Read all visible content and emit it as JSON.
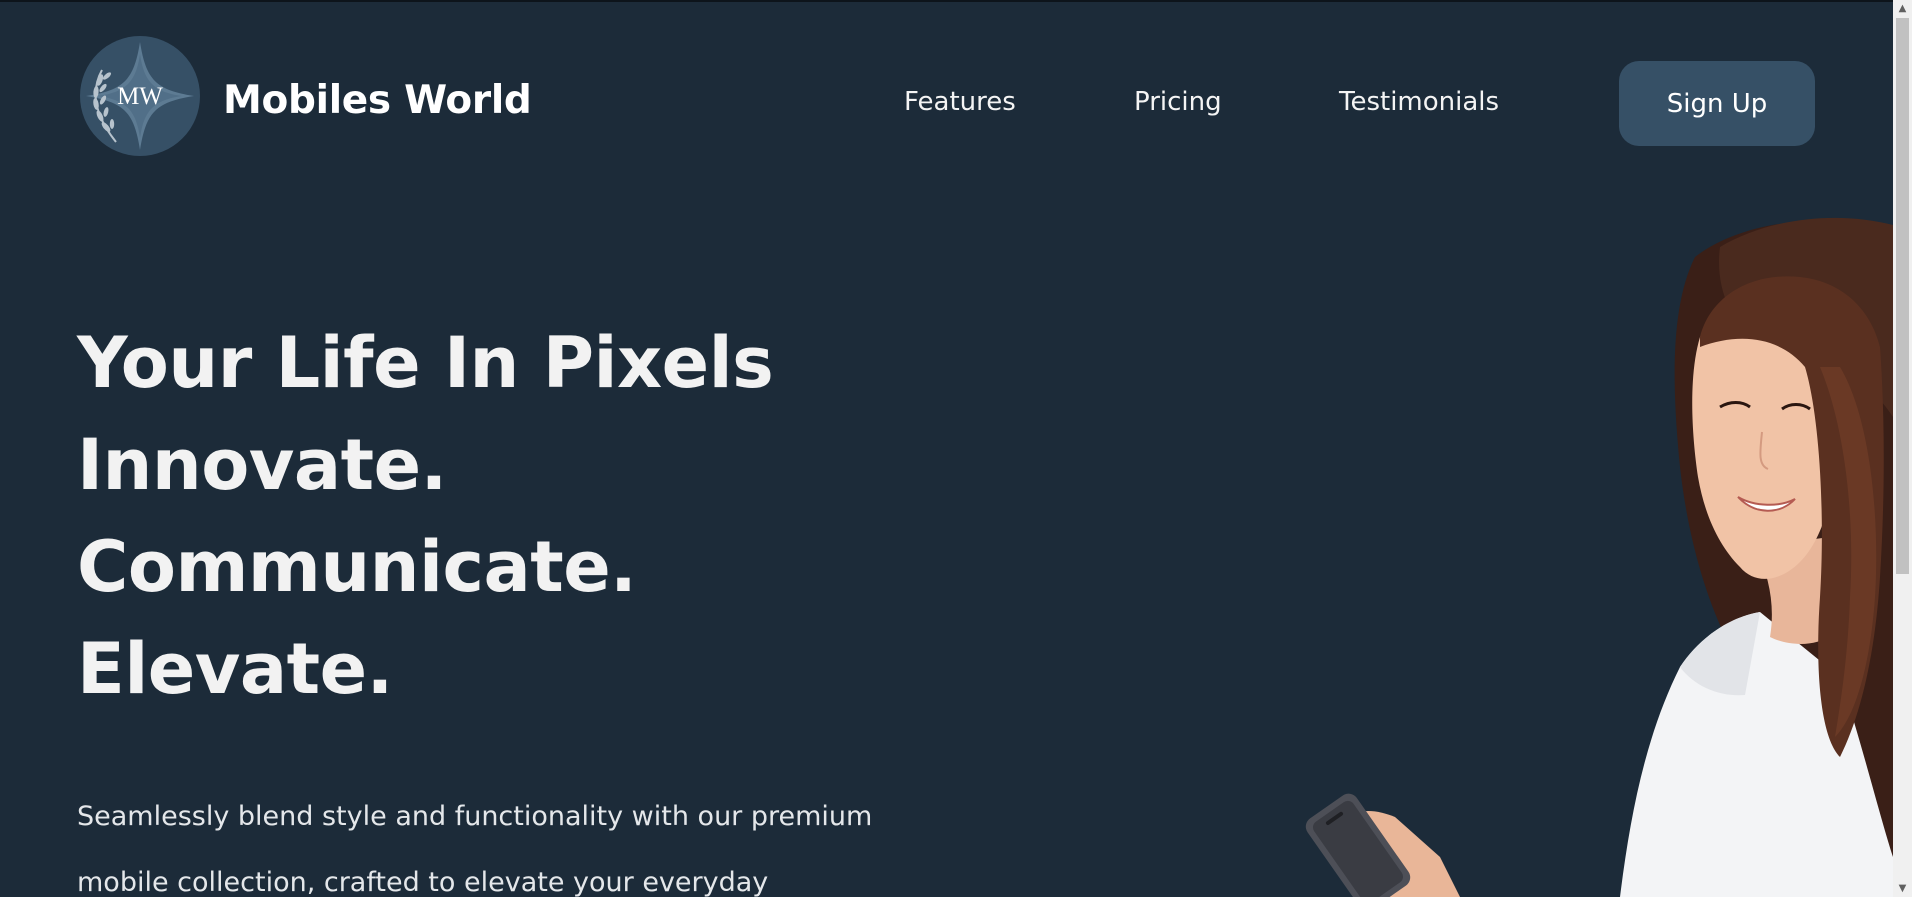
{
  "header": {
    "logo_monogram": "MW",
    "brand_name": "Mobiles World",
    "nav": {
      "features": "Features",
      "pricing": "Pricing",
      "testimonials": "Testimonials"
    },
    "signup_label": "Sign Up"
  },
  "hero": {
    "lines": [
      "Your Life In Pixels",
      "Innovate.",
      "Communicate.",
      "Elevate."
    ],
    "description_lines": [
      "Seamlessly blend style and functionality with our premium",
      "mobile collection, crafted to elevate your everyday"
    ],
    "image": "woman-with-phone"
  },
  "colors": {
    "background": "#1c2b39",
    "button": "#365066",
    "text": "#f2f2f2"
  },
  "icons": {
    "logo": "mw-star-laurel-logo",
    "scroll_up": "arrow-up-icon",
    "scroll_down": "arrow-down-icon"
  }
}
